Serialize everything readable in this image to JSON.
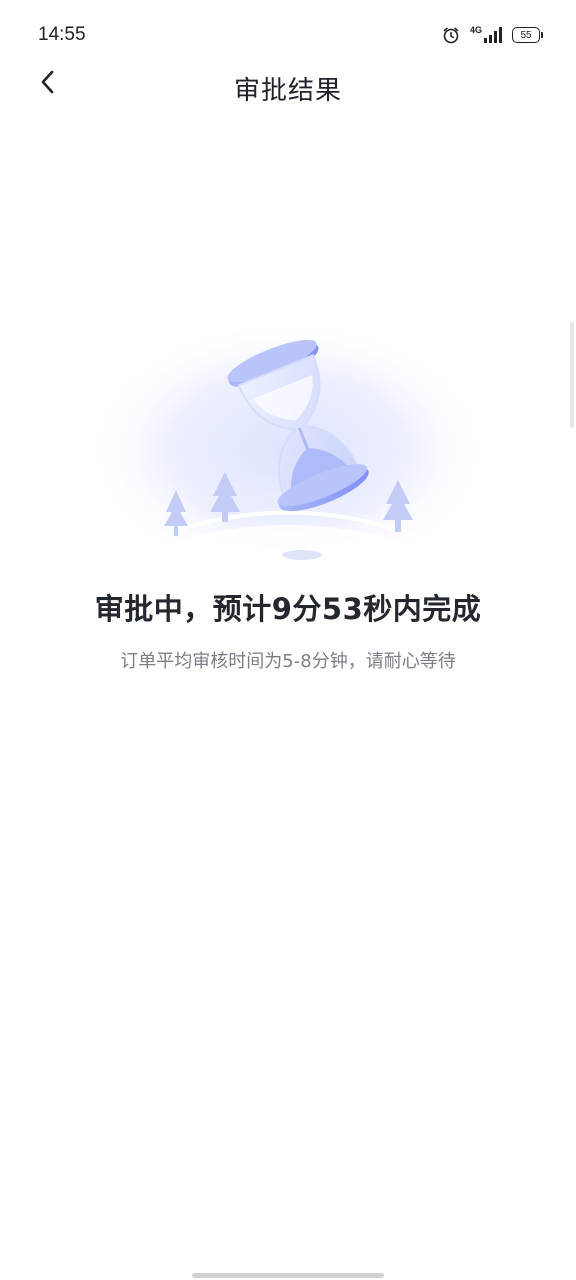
{
  "status_bar": {
    "time": "14:55",
    "network": "4G",
    "battery": "55",
    "icons": [
      "alarm-icon",
      "signal-icon",
      "battery-icon"
    ]
  },
  "nav": {
    "back_icon": "chevron-left-icon",
    "title": "审批结果"
  },
  "result": {
    "illustration_icon": "hourglass-icon",
    "heading": "审批中，预计9分53秒内完成",
    "subtext": "订单平均审核时间为5-8分钟，请耐心等待"
  },
  "colors": {
    "accent": "#8d9cf5",
    "accent_light": "#dfe4ff",
    "heading": "#24272d",
    "subtext": "#7a7f87"
  }
}
